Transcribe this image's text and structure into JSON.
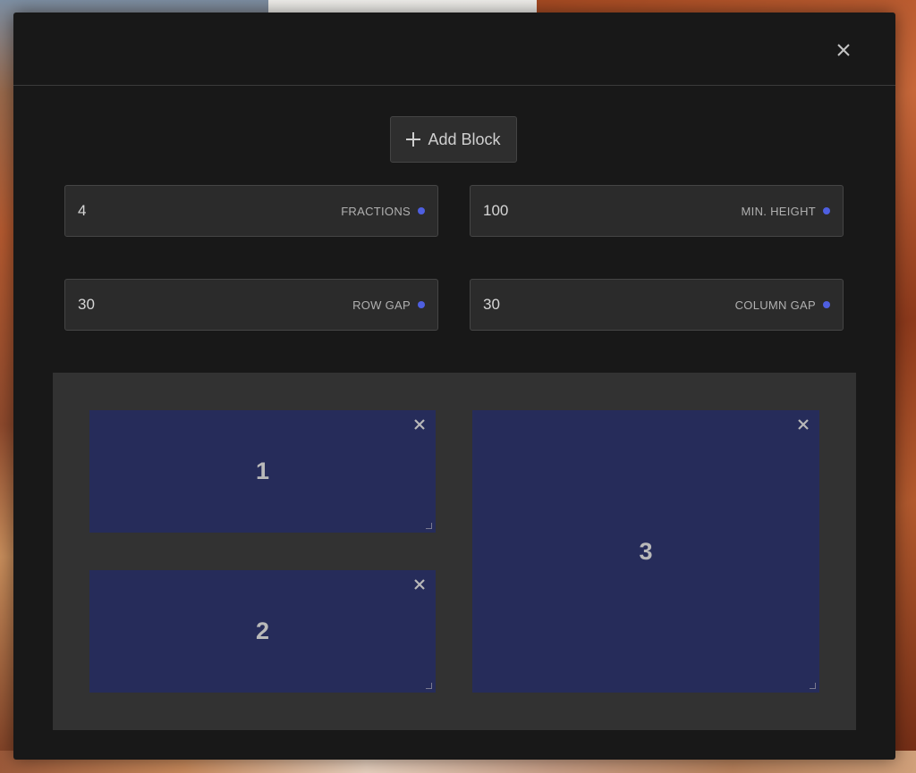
{
  "modal": {
    "close_icon": "close-icon"
  },
  "toolbar": {
    "add_block_label": "Add Block",
    "add_block_icon": "plus-icon"
  },
  "settings": {
    "fractions": {
      "value": "4",
      "label": "FRACTIONS"
    },
    "min_height": {
      "value": "100",
      "label": "MIN. HEIGHT"
    },
    "row_gap": {
      "value": "30",
      "label": "ROW GAP"
    },
    "column_gap": {
      "value": "30",
      "label": "COLUMN GAP"
    },
    "indicator_color": "#4e5fe0"
  },
  "blocks": [
    {
      "label": "1"
    },
    {
      "label": "2"
    },
    {
      "label": "3"
    }
  ],
  "colors": {
    "modal_bg": "#181818",
    "field_bg": "#2b2b2b",
    "grid_bg": "#323232",
    "block_bg": "#262c5a"
  }
}
